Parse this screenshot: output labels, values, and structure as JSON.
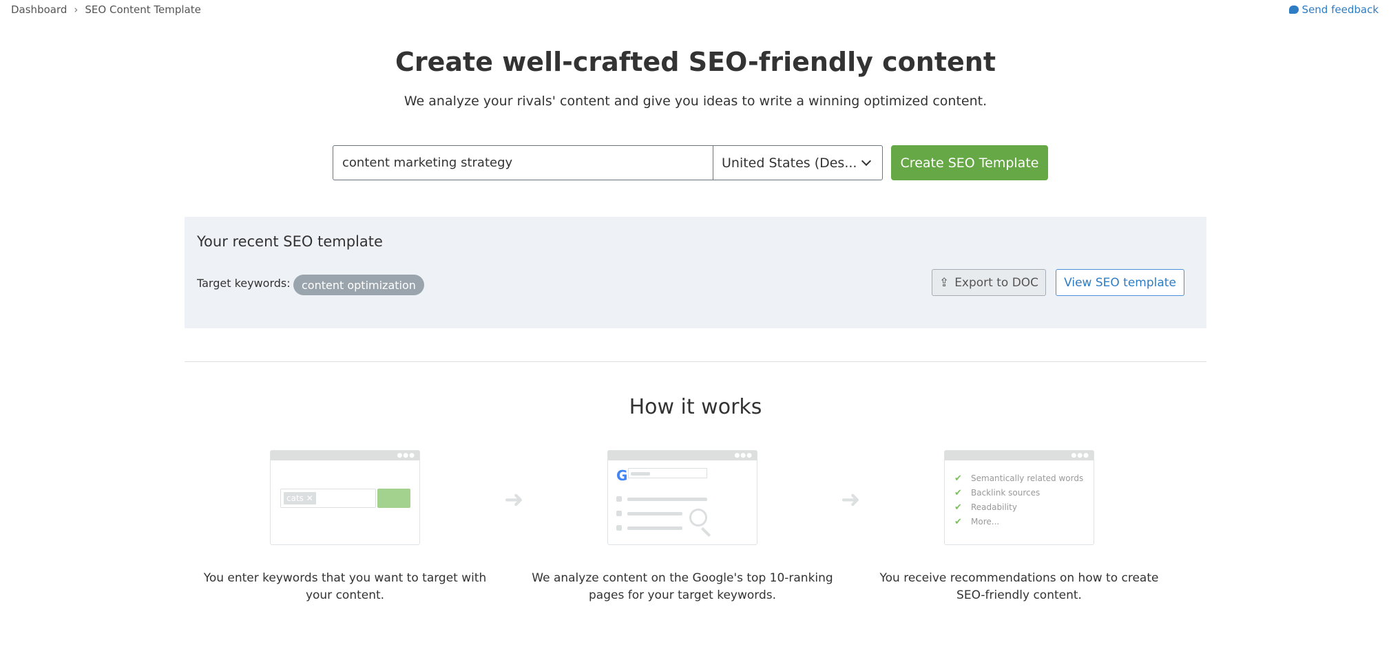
{
  "breadcrumb": [
    "Dashboard",
    "SEO Content Template"
  ],
  "feedback": "Send feedback",
  "header": {
    "title": "Create well-crafted SEO-friendly content",
    "subtitle": "We analyze your rivals' content and give you ideas to write a winning optimized content."
  },
  "form": {
    "keyword_value": "content marketing strategy",
    "location": "United States (Des...",
    "create_label": "Create SEO Template"
  },
  "recent": {
    "title": "Your recent SEO template",
    "keywords_label": "Target keywords:",
    "keywords": [
      "content optimization"
    ],
    "export_label": "Export to DOC",
    "view_label": "View SEO template"
  },
  "how": {
    "title": "How it works",
    "step1_chip": "cats",
    "step3_items": [
      "Semantically related words",
      "Backlink sources",
      "Readability",
      "More..."
    ],
    "captions": [
      "You enter keywords that you want to target with your content.",
      "We analyze content on the Google's top 10-ranking pages for your target keywords.",
      "You receive recommendations on how to create SEO-friendly content."
    ]
  },
  "colors": {
    "accent": "#66a845",
    "link": "#2e7cc4",
    "panel": "#eef1f5"
  }
}
